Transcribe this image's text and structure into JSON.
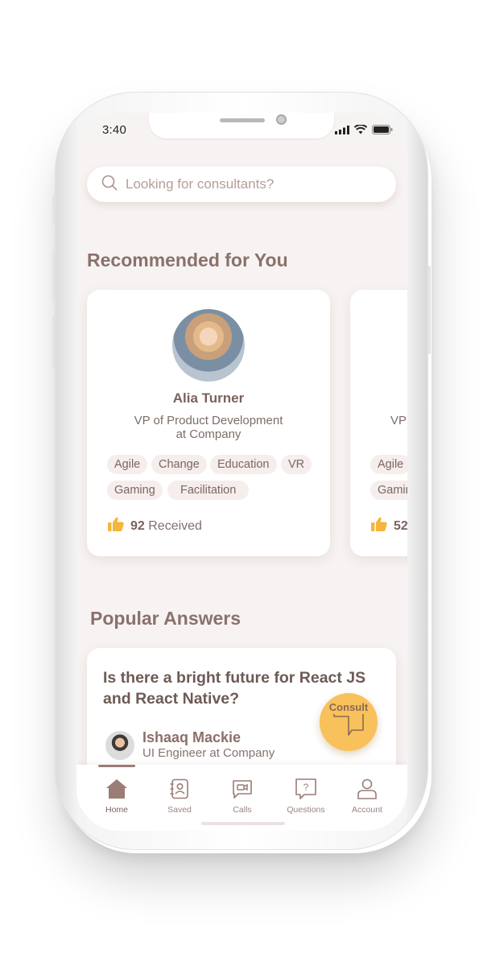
{
  "status": {
    "time": "3:40"
  },
  "search": {
    "placeholder": "Looking for consultants?"
  },
  "recommended": {
    "title": "Recommended for You",
    "cards": [
      {
        "name": "Alia Turner",
        "role_line1": "VP of Product Development",
        "role_line2": "at Company",
        "tags": [
          "Agile",
          "Change",
          "Education",
          "VR",
          "Gaming",
          "Facilitation"
        ],
        "likes_count": "92",
        "likes_label": "Received"
      },
      {
        "role_partial": "VP",
        "tags_partial": [
          "Agile",
          "Gamin"
        ],
        "likes_partial": "52"
      }
    ]
  },
  "popular": {
    "title": "Popular Answers",
    "question": "Is there a bright future for React JS and React Native?",
    "author_name": "Ishaaq Mackie",
    "author_role": "UI Engineer at Company"
  },
  "fab": {
    "label": "Consult"
  },
  "nav": {
    "items": [
      {
        "label": "Home",
        "icon": "home-icon",
        "active": true
      },
      {
        "label": "Saved",
        "icon": "contact-book-icon",
        "active": false
      },
      {
        "label": "Calls",
        "icon": "video-call-icon",
        "active": false
      },
      {
        "label": "Questions",
        "icon": "question-icon",
        "active": false
      },
      {
        "label": "Account",
        "icon": "person-icon",
        "active": false
      }
    ]
  },
  "colors": {
    "screen_bg": "#f7f3f2",
    "accent_brown": "#8a716b",
    "fab_yellow": "#f8c15c",
    "thumb_yellow": "#f6b53b"
  }
}
